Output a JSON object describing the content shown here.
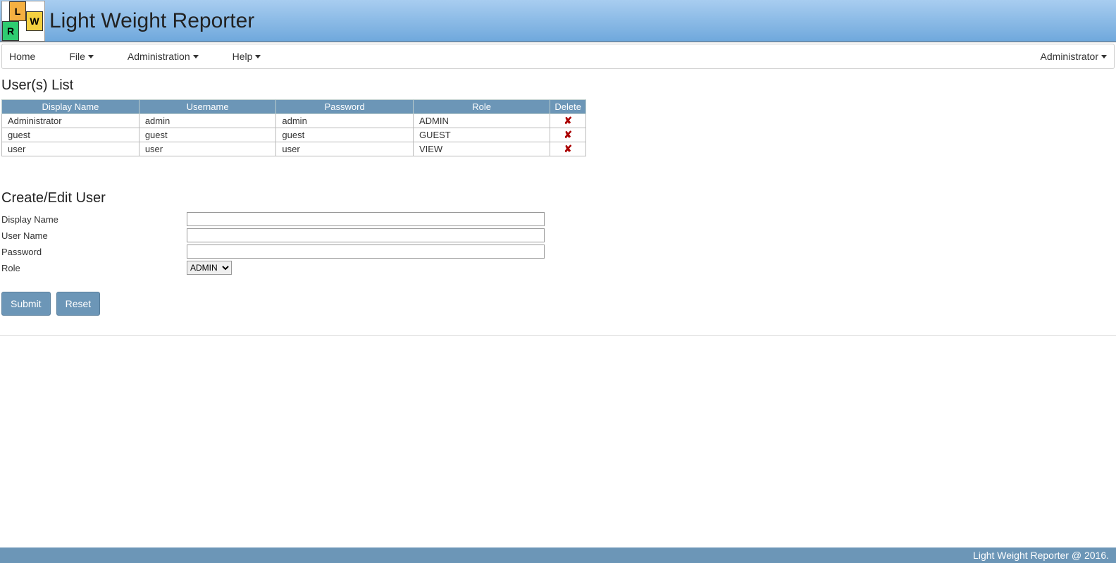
{
  "header": {
    "app_title": "Light Weight Reporter"
  },
  "nav": {
    "home": "Home",
    "file": "File",
    "administration": "Administration",
    "help": "Help",
    "user_menu": "Administrator"
  },
  "users_list": {
    "title": "User(s) List",
    "columns": {
      "display_name": "Display Name",
      "username": "Username",
      "password": "Password",
      "role": "Role",
      "delete": "Delete"
    },
    "rows": [
      {
        "display_name": "Administrator",
        "username": "admin",
        "password": "admin",
        "role": "ADMIN"
      },
      {
        "display_name": "guest",
        "username": "guest",
        "password": "guest",
        "role": "GUEST"
      },
      {
        "display_name": "user",
        "username": "user",
        "password": "user",
        "role": "VIEW"
      }
    ]
  },
  "form": {
    "title": "Create/Edit User",
    "labels": {
      "display_name": "Display Name",
      "user_name": "User Name",
      "password": "Password",
      "role": "Role"
    },
    "values": {
      "display_name": "",
      "user_name": "",
      "password": "",
      "role_selected": "ADMIN"
    },
    "buttons": {
      "submit": "Submit",
      "reset": "Reset"
    }
  },
  "footer": {
    "text": "Light Weight Reporter @ 2016."
  }
}
